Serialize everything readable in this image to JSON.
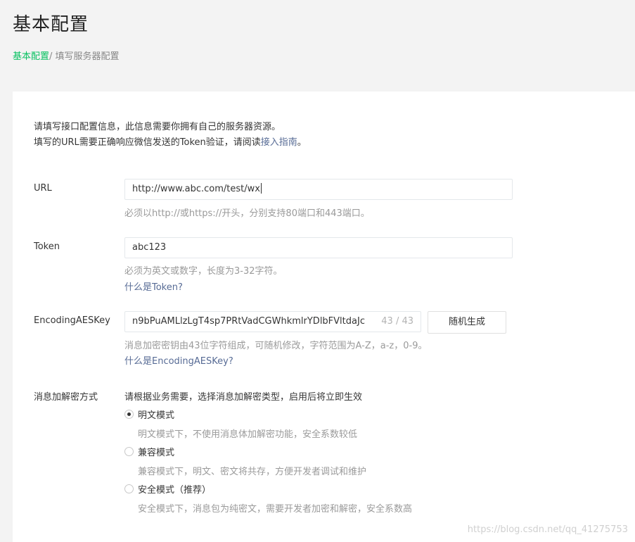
{
  "header": {
    "title": "基本配置",
    "breadcrumb_link": "基本配置",
    "breadcrumb_current": "/ 填写服务器配置"
  },
  "intro": {
    "line1": "请填写接口配置信息，此信息需要你拥有自己的服务器资源。",
    "line2_prefix": "填写的URL需要正确响应微信发送的Token验证，请阅读",
    "line2_link": "接入指南",
    "line2_suffix": "。"
  },
  "form": {
    "url": {
      "label": "URL",
      "value": "http://www.abc.com/test/wx",
      "tip": "必须以http://或https://开头，分别支持80端口和443端口。"
    },
    "token": {
      "label": "Token",
      "value": "abc123",
      "tip": "必须为英文或数字，长度为3-32字符。",
      "help": "什么是Token?"
    },
    "aeskey": {
      "label": "EncodingAESKey",
      "value": "n9bPuAMLlzLgT4sp7PRtVadCGWhkmlrYDlbFVltdaJc",
      "counter": "43 / 43",
      "generate_button": "随机生成",
      "tip": "消息加密密钥由43位字符组成，可随机修改，字符范围为A-Z，a-z，0-9。",
      "help": "什么是EncodingAESKey?"
    },
    "encryption": {
      "label": "消息加解密方式",
      "description": "请根据业务需要，选择消息加解密类型，启用后将立即生效",
      "options": [
        {
          "label": "明文模式",
          "desc": "明文模式下，不使用消息体加解密功能，安全系数较低",
          "selected": true
        },
        {
          "label": "兼容模式",
          "desc": "兼容模式下，明文、密文将共存，方便开发者调试和维护",
          "selected": false
        },
        {
          "label": "安全模式（推荐）",
          "desc": "安全模式下，消息包为纯密文，需要开发者加密和解密，安全系数高",
          "selected": false
        }
      ]
    }
  },
  "watermark": "https://blog.csdn.net/qq_41275753"
}
